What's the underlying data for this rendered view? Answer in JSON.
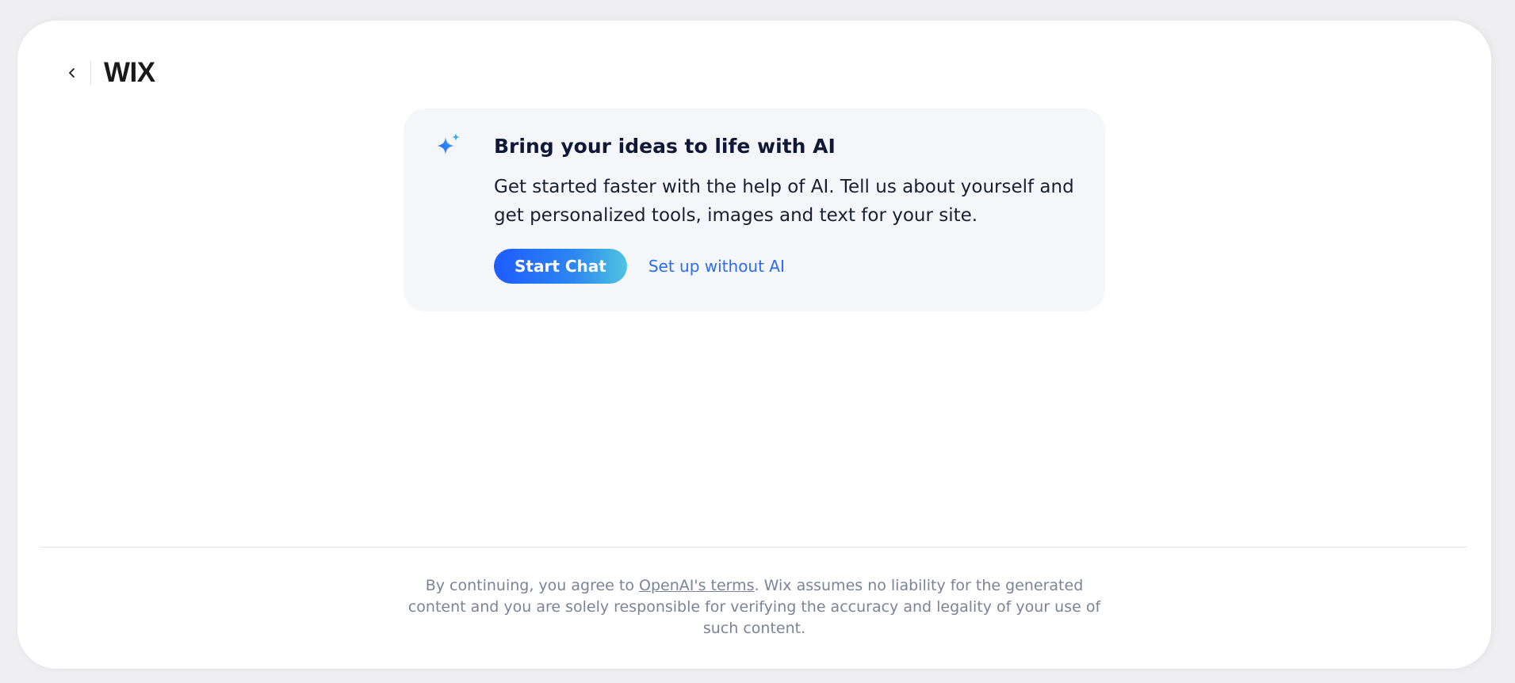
{
  "header": {
    "logo_text": "WIX",
    "back_icon": "chevron-left-icon"
  },
  "ai_card": {
    "icon": "sparkle-icon",
    "title": "Bring your ideas to life with AI",
    "body": "Get started faster with the help of AI. Tell us about yourself and get personalized tools, images and text for your site.",
    "primary_button_label": "Start Chat",
    "secondary_link_label": "Set up without AI"
  },
  "footer": {
    "disclaimer_prefix": "By continuing, you agree to ",
    "terms_link_label": "OpenAI's terms",
    "disclaimer_suffix": ". Wix assumes no liability for the generated content and you are solely responsible for verifying the accuracy and legality of your use of such content."
  },
  "colors": {
    "accent": "#2a6cec",
    "button_gradient_start": "#1e5bff",
    "button_gradient_end": "#50c4e0",
    "card_background": "#f5f6f9",
    "page_background": "#efeff2"
  }
}
